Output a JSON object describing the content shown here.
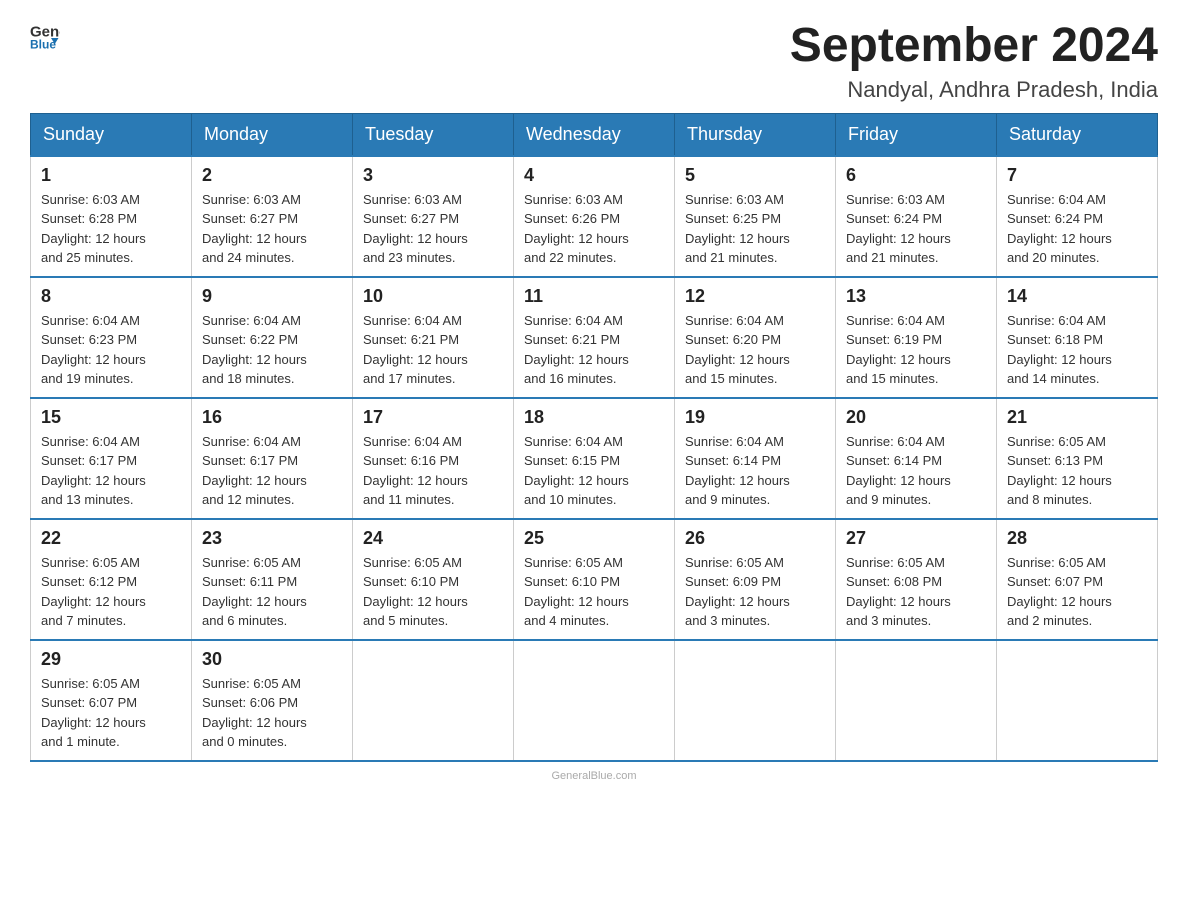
{
  "header": {
    "logo": {
      "general": "General",
      "blue": "Blue"
    },
    "title": "September 2024",
    "location": "Nandyal, Andhra Pradesh, India"
  },
  "days_of_week": [
    "Sunday",
    "Monday",
    "Tuesday",
    "Wednesday",
    "Thursday",
    "Friday",
    "Saturday"
  ],
  "weeks": [
    [
      {
        "day": "1",
        "sunrise": "6:03 AM",
        "sunset": "6:28 PM",
        "daylight": "12 hours and 25 minutes."
      },
      {
        "day": "2",
        "sunrise": "6:03 AM",
        "sunset": "6:27 PM",
        "daylight": "12 hours and 24 minutes."
      },
      {
        "day": "3",
        "sunrise": "6:03 AM",
        "sunset": "6:27 PM",
        "daylight": "12 hours and 23 minutes."
      },
      {
        "day": "4",
        "sunrise": "6:03 AM",
        "sunset": "6:26 PM",
        "daylight": "12 hours and 22 minutes."
      },
      {
        "day": "5",
        "sunrise": "6:03 AM",
        "sunset": "6:25 PM",
        "daylight": "12 hours and 21 minutes."
      },
      {
        "day": "6",
        "sunrise": "6:03 AM",
        "sunset": "6:24 PM",
        "daylight": "12 hours and 21 minutes."
      },
      {
        "day": "7",
        "sunrise": "6:04 AM",
        "sunset": "6:24 PM",
        "daylight": "12 hours and 20 minutes."
      }
    ],
    [
      {
        "day": "8",
        "sunrise": "6:04 AM",
        "sunset": "6:23 PM",
        "daylight": "12 hours and 19 minutes."
      },
      {
        "day": "9",
        "sunrise": "6:04 AM",
        "sunset": "6:22 PM",
        "daylight": "12 hours and 18 minutes."
      },
      {
        "day": "10",
        "sunrise": "6:04 AM",
        "sunset": "6:21 PM",
        "daylight": "12 hours and 17 minutes."
      },
      {
        "day": "11",
        "sunrise": "6:04 AM",
        "sunset": "6:21 PM",
        "daylight": "12 hours and 16 minutes."
      },
      {
        "day": "12",
        "sunrise": "6:04 AM",
        "sunset": "6:20 PM",
        "daylight": "12 hours and 15 minutes."
      },
      {
        "day": "13",
        "sunrise": "6:04 AM",
        "sunset": "6:19 PM",
        "daylight": "12 hours and 15 minutes."
      },
      {
        "day": "14",
        "sunrise": "6:04 AM",
        "sunset": "6:18 PM",
        "daylight": "12 hours and 14 minutes."
      }
    ],
    [
      {
        "day": "15",
        "sunrise": "6:04 AM",
        "sunset": "6:17 PM",
        "daylight": "12 hours and 13 minutes."
      },
      {
        "day": "16",
        "sunrise": "6:04 AM",
        "sunset": "6:17 PM",
        "daylight": "12 hours and 12 minutes."
      },
      {
        "day": "17",
        "sunrise": "6:04 AM",
        "sunset": "6:16 PM",
        "daylight": "12 hours and 11 minutes."
      },
      {
        "day": "18",
        "sunrise": "6:04 AM",
        "sunset": "6:15 PM",
        "daylight": "12 hours and 10 minutes."
      },
      {
        "day": "19",
        "sunrise": "6:04 AM",
        "sunset": "6:14 PM",
        "daylight": "12 hours and 9 minutes."
      },
      {
        "day": "20",
        "sunrise": "6:04 AM",
        "sunset": "6:14 PM",
        "daylight": "12 hours and 9 minutes."
      },
      {
        "day": "21",
        "sunrise": "6:05 AM",
        "sunset": "6:13 PM",
        "daylight": "12 hours and 8 minutes."
      }
    ],
    [
      {
        "day": "22",
        "sunrise": "6:05 AM",
        "sunset": "6:12 PM",
        "daylight": "12 hours and 7 minutes."
      },
      {
        "day": "23",
        "sunrise": "6:05 AM",
        "sunset": "6:11 PM",
        "daylight": "12 hours and 6 minutes."
      },
      {
        "day": "24",
        "sunrise": "6:05 AM",
        "sunset": "6:10 PM",
        "daylight": "12 hours and 5 minutes."
      },
      {
        "day": "25",
        "sunrise": "6:05 AM",
        "sunset": "6:10 PM",
        "daylight": "12 hours and 4 minutes."
      },
      {
        "day": "26",
        "sunrise": "6:05 AM",
        "sunset": "6:09 PM",
        "daylight": "12 hours and 3 minutes."
      },
      {
        "day": "27",
        "sunrise": "6:05 AM",
        "sunset": "6:08 PM",
        "daylight": "12 hours and 3 minutes."
      },
      {
        "day": "28",
        "sunrise": "6:05 AM",
        "sunset": "6:07 PM",
        "daylight": "12 hours and 2 minutes."
      }
    ],
    [
      {
        "day": "29",
        "sunrise": "6:05 AM",
        "sunset": "6:07 PM",
        "daylight": "12 hours and 1 minute."
      },
      {
        "day": "30",
        "sunrise": "6:05 AM",
        "sunset": "6:06 PM",
        "daylight": "12 hours and 0 minutes."
      },
      null,
      null,
      null,
      null,
      null
    ]
  ],
  "labels": {
    "sunrise": "Sunrise:",
    "sunset": "Sunset:",
    "daylight": "Daylight:"
  }
}
